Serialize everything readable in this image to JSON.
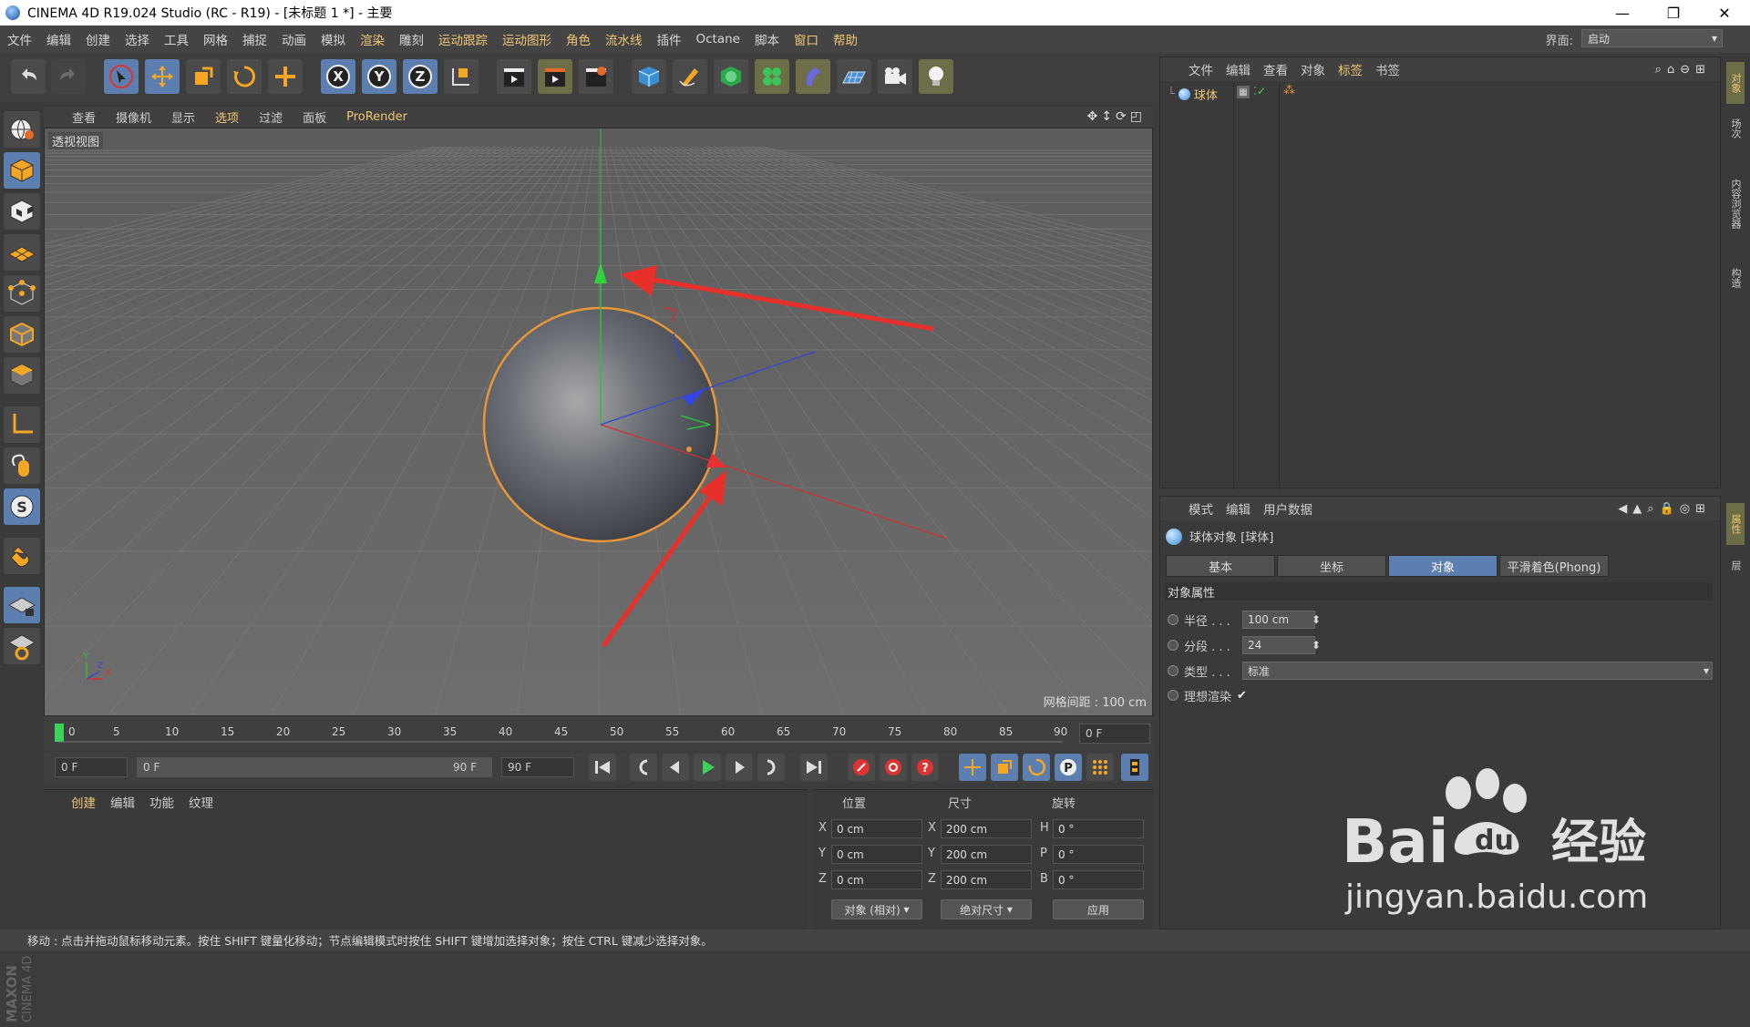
{
  "titlebar": {
    "title": "CINEMA 4D R19.024 Studio (RC - R19) - [未标题 1 *] - 主要"
  },
  "menubar": {
    "items": [
      "文件",
      "编辑",
      "创建",
      "选择",
      "工具",
      "网格",
      "捕捉",
      "动画",
      "模拟",
      "渲染",
      "雕刻",
      "运动跟踪",
      "运动图形",
      "角色",
      "流水线",
      "插件",
      "Octane",
      "脚本",
      "窗口",
      "帮助"
    ],
    "interface_label": "界面:",
    "interface_value": "启动"
  },
  "viewport_menu": {
    "items": [
      "查看",
      "摄像机",
      "显示",
      "选项",
      "过滤",
      "面板",
      "ProRender"
    ]
  },
  "viewport": {
    "label": "透视视图",
    "grid_spacing": "网格间距 : 100 cm"
  },
  "timeline": {
    "ticks": [
      "0",
      "5",
      "10",
      "15",
      "20",
      "25",
      "30",
      "35",
      "40",
      "45",
      "50",
      "55",
      "60",
      "65",
      "70",
      "75",
      "80",
      "85",
      "90"
    ],
    "current_frame": "0 F",
    "start_frame": "0 F",
    "range_start": "0 F",
    "range_end": "90 F",
    "end_frame": "90 F"
  },
  "material_panel": {
    "tabs": [
      "创建",
      "编辑",
      "功能",
      "纹理"
    ]
  },
  "coord_panel": {
    "headers": [
      "位置",
      "尺寸",
      "旋转"
    ],
    "rows": [
      {
        "axis_pos": "X",
        "pos": "0 cm",
        "axis_size": "X",
        "size": "200 cm",
        "axis_rot": "H",
        "rot": "0 °"
      },
      {
        "axis_pos": "Y",
        "pos": "0 cm",
        "axis_size": "Y",
        "size": "200 cm",
        "axis_rot": "P",
        "rot": "0 °"
      },
      {
        "axis_pos": "Z",
        "pos": "0 cm",
        "axis_size": "Z",
        "size": "200 cm",
        "axis_rot": "B",
        "rot": "0 °"
      }
    ],
    "mode_select": "对象 (相对)",
    "size_select": "绝对尺寸",
    "apply_label": "应用"
  },
  "statusbar": {
    "text": "移动 : 点击并拖动鼠标移动元素。按住 SHIFT 键量化移动；节点编辑模式时按住 SHIFT 键增加选择对象；按住 CTRL 键减少选择对象。"
  },
  "object_manager": {
    "menu": [
      "文件",
      "编辑",
      "查看",
      "对象",
      "标签",
      "书签"
    ],
    "objects": [
      {
        "name": "球体"
      }
    ]
  },
  "attribute_manager": {
    "menu": [
      "模式",
      "编辑",
      "用户数据"
    ],
    "object_title": "球体对象 [球体]",
    "tabs": [
      "基本",
      "坐标",
      "对象",
      "平滑着色(Phong)"
    ],
    "active_tab": "对象",
    "section": "对象属性",
    "fields": [
      {
        "label": "半径 . . .",
        "value": "100 cm"
      },
      {
        "label": "分段 . . .",
        "value": "24"
      },
      {
        "label": "类型 . . .",
        "value": "标准"
      },
      {
        "label": "理想渲染",
        "value": "✔"
      }
    ]
  },
  "right_strip": {
    "tabs": [
      "对象",
      "场次",
      "内容浏览器",
      "构造"
    ],
    "tabs_lower": [
      "属性",
      "层"
    ]
  },
  "colors": {
    "accent_blue": "#5d7fb0",
    "highlight_text": "#f0c674",
    "panel_bg": "#3a3a3a",
    "arrow_red": "#e8302b"
  },
  "watermark": {
    "brand": "Bai",
    "du": "du",
    "cn": "经验",
    "url": "jingyan.baidu.com"
  },
  "maxon": {
    "line1": "MAXON",
    "line2": "CINEMA 4D"
  }
}
